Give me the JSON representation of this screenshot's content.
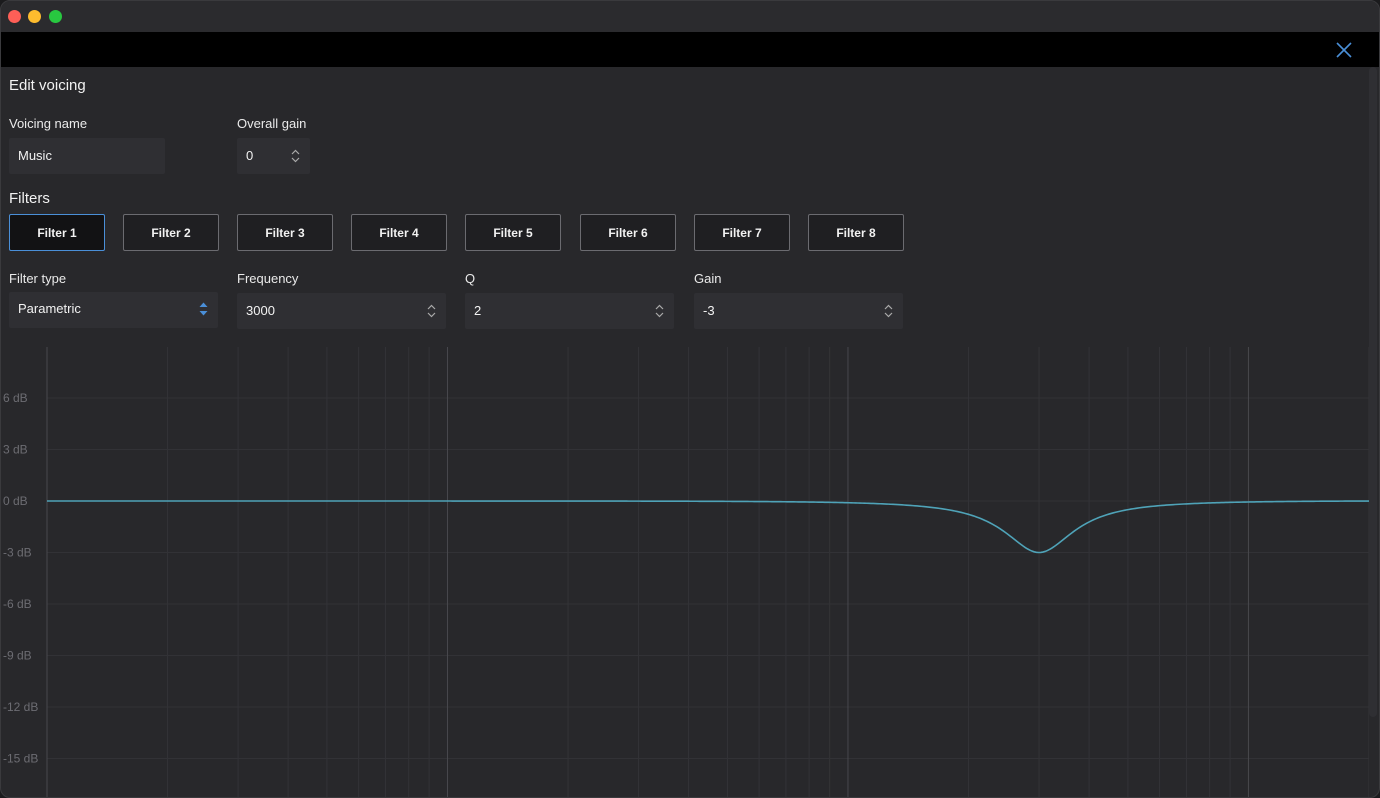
{
  "dialog": {
    "title": "Edit voicing",
    "voicing_name_label": "Voicing name",
    "voicing_name_value": "Music",
    "overall_gain_label": "Overall gain",
    "overall_gain_value": "0"
  },
  "filters": {
    "section_title": "Filters",
    "tabs": [
      "Filter 1",
      "Filter 2",
      "Filter 3",
      "Filter 4",
      "Filter 5",
      "Filter 6",
      "Filter 7",
      "Filter 8"
    ],
    "active_tab": "Filter 1",
    "filter_type_label": "Filter type",
    "filter_type_value": "Parametric",
    "frequency_label": "Frequency",
    "frequency_value": "3000",
    "q_label": "Q",
    "q_value": "2",
    "gain_label": "Gain",
    "gain_value": "-3"
  },
  "colors": {
    "accent": "#4a8fd8",
    "curve": "#4fa3b8"
  },
  "chart_data": {
    "type": "line",
    "x_scale": "log",
    "xlim": [
      10,
      20000
    ],
    "ylim": [
      -15,
      9
    ],
    "y_tick_labels": [
      "6 dB",
      "3 dB",
      "0 dB",
      "-3 dB",
      "-6 dB",
      "-9 dB",
      "-12 dB",
      "-15 dB"
    ],
    "y_ticks": [
      6,
      3,
      0,
      -3,
      -6,
      -9,
      -12,
      -15
    ],
    "grid": true,
    "series": [
      {
        "filter": "parametric",
        "center_frequency": 3000,
        "q": 2,
        "gain_db": -3
      }
    ]
  }
}
